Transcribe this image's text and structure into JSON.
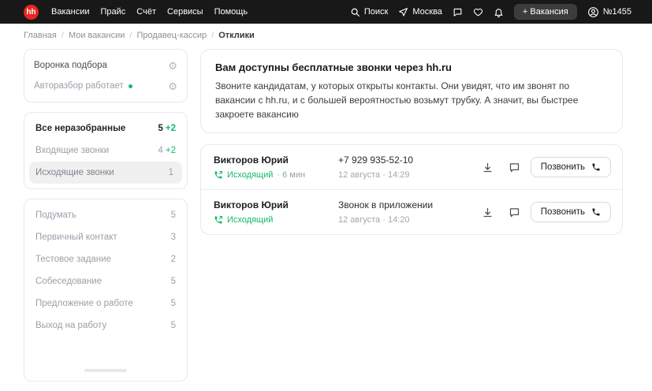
{
  "colors": {
    "brand_red": "#e8261f",
    "accent_green": "#14b96a",
    "header_bg": "#181818"
  },
  "icons": {
    "gear_glyph": "⚙"
  },
  "header": {
    "logo_text": "hh",
    "nav": [
      {
        "label": "Вакансии"
      },
      {
        "label": "Прайс"
      },
      {
        "label": "Счёт"
      },
      {
        "label": "Сервисы"
      },
      {
        "label": "Помощь"
      }
    ],
    "search_label": "Поиск",
    "city_label": "Москва",
    "vacancy_button_label": "+ Вакансия",
    "account_label": "№1455"
  },
  "breadcrumb": {
    "items": [
      {
        "label": "Главная"
      },
      {
        "label": "Мои вакансии"
      },
      {
        "label": "Продавец-кассир"
      },
      {
        "label": "Отклики"
      }
    ]
  },
  "sidebar": {
    "funnel_label": "Воронка подбора",
    "autoreview_label": "Авторазбор работает",
    "folders": [
      {
        "label": "Все неразобранные",
        "count": "5",
        "extra": "+2"
      },
      {
        "label": "Входящие звонки",
        "count": "4",
        "extra": "+2"
      },
      {
        "label": "Исходящие звонки",
        "count": "1",
        "extra": ""
      }
    ],
    "stages": [
      {
        "label": "Подумать",
        "count": "5"
      },
      {
        "label": "Первичный контакт",
        "count": "3"
      },
      {
        "label": "Тестовое задание",
        "count": "2"
      },
      {
        "label": "Собеседование",
        "count": "5"
      },
      {
        "label": "Предложение о работе",
        "count": "5"
      },
      {
        "label": "Выход на работу",
        "count": "5"
      }
    ]
  },
  "main": {
    "promo": {
      "title": "Вам доступны бесплатные звонки через hh.ru",
      "body": "Звоните кандидатам, у которых открыты контакты. Они увидят, что им звонят по вакансии с hh.ru, и с большей вероятностью возьмут трубку. А значит, вы быстрее закроете вакансию"
    },
    "calls": [
      {
        "name": "Викторов Юрий",
        "type": "Исходящий",
        "duration": "· 6 мин",
        "contact": "+7 929 935-52-10",
        "date": "12 августа · 14:29",
        "button": "Позвонить"
      },
      {
        "name": "Викторов Юрий",
        "type": "Исходящий",
        "duration": "",
        "contact": "Звонок в приложении",
        "date": "12 августа · 14:20",
        "button": "Позвонить"
      }
    ]
  }
}
